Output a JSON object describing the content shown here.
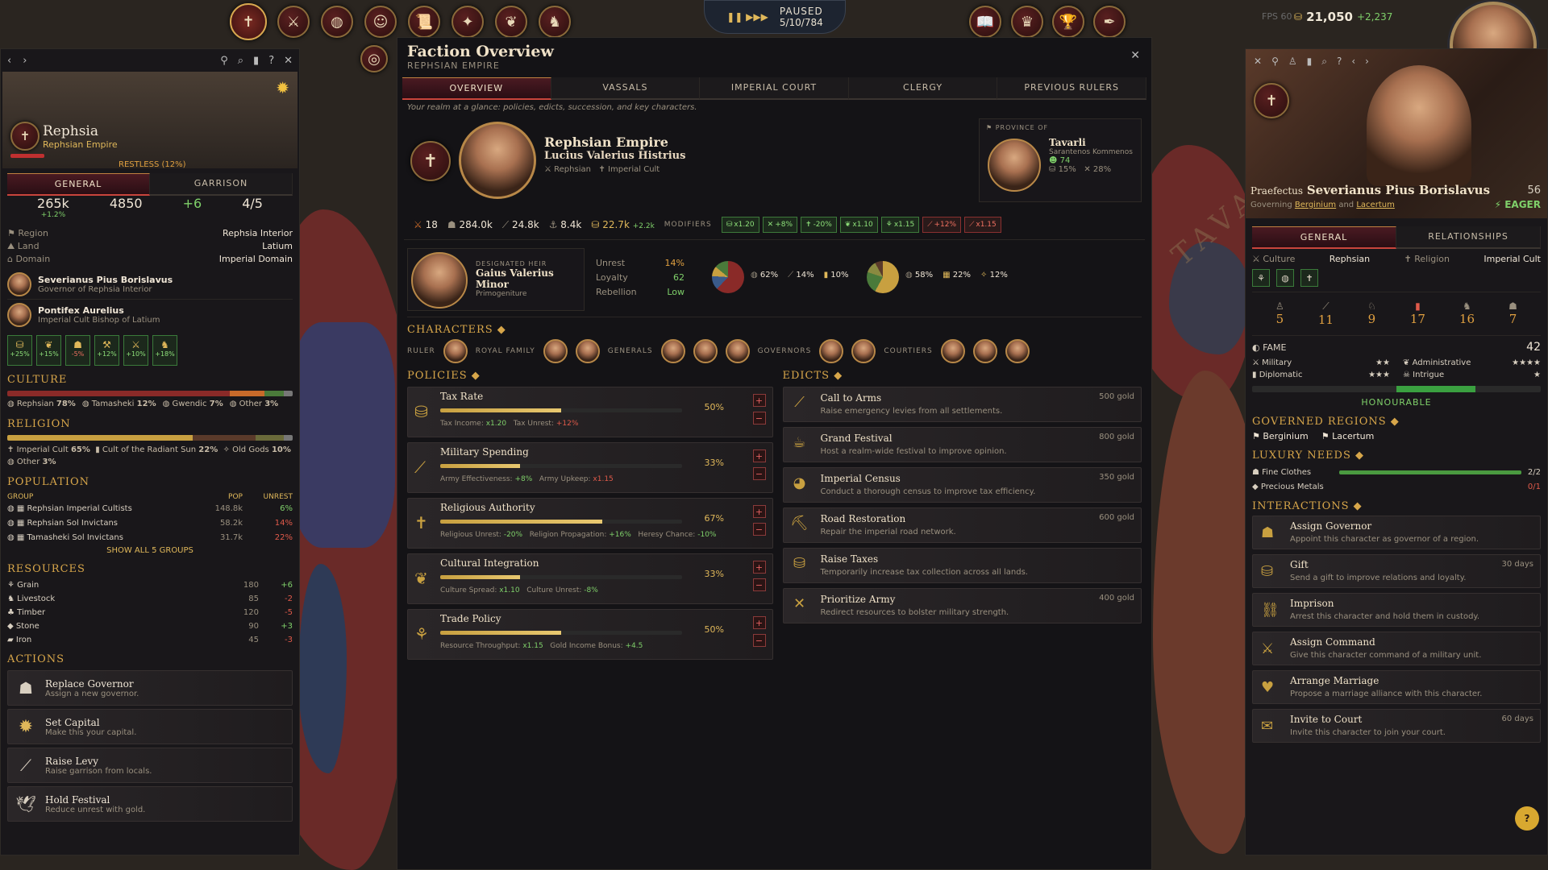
{
  "topbar": {
    "icons_left": [
      "cross-icon",
      "sword-icon",
      "globe-icon",
      "bust-icon",
      "scroll-icon",
      "map-icon",
      "laurel-icon",
      "soldier-icon"
    ],
    "icons_right": [
      "book-icon",
      "crown-helmet-icon",
      "trophy-icon",
      "quill-icon"
    ],
    "status": "PAUSED",
    "date": "5/10/784",
    "speed": "▮▮ ▶▶▶",
    "fps": "FPS 60",
    "gold": "21,050",
    "gold_delta": "+2,237"
  },
  "left": {
    "faction_name": "Rephsia",
    "faction_sub": "Rephsian Empire",
    "mood": "RESTLESS (12%)",
    "tabs": [
      "GENERAL",
      "GARRISON"
    ],
    "stats": [
      {
        "v": "265k",
        "s": "+1.2%"
      },
      {
        "v": "4850",
        "s": ""
      },
      {
        "v": "+6",
        "s": ""
      },
      {
        "v": "4/5",
        "s": ""
      }
    ],
    "info": [
      {
        "k": "Region",
        "v": "Rephsia Interior"
      },
      {
        "k": "Land",
        "v": "Latium"
      },
      {
        "k": "Domain",
        "v": "Imperial Domain"
      }
    ],
    "people": [
      {
        "name": "Severianus Pius Borislavus",
        "role": "Governor of Rephsia Interior"
      },
      {
        "name": "Pontifex Aurelius",
        "role": "Imperial Cult Bishop of Latium"
      }
    ],
    "bonuses": [
      "+25%",
      "+15%",
      "-5%",
      "+12%",
      "+10%",
      "+18%"
    ],
    "culture_title": "CULTURE",
    "culture": [
      {
        "n": "Rephsian",
        "p": "78%"
      },
      {
        "n": "Tamasheki",
        "p": "12%"
      },
      {
        "n": "Gwendic",
        "p": "7%"
      },
      {
        "n": "Other",
        "p": "3%"
      }
    ],
    "religion_title": "RELIGION",
    "religion": [
      {
        "n": "Imperial Cult",
        "p": "65%"
      },
      {
        "n": "Cult of the Radiant Sun",
        "p": "22%"
      },
      {
        "n": "Old Gods",
        "p": "10%"
      },
      {
        "n": "Other",
        "p": "3%"
      }
    ],
    "population_title": "POPULATION",
    "pop_headers": [
      "GROUP",
      "POP",
      "UNREST"
    ],
    "pop": [
      {
        "g": "Rephsian Imperial Cultists",
        "p": "148.8k",
        "u": "6%"
      },
      {
        "g": "Rephsian Sol Invictans",
        "p": "58.2k",
        "u": "14%"
      },
      {
        "g": "Tamasheki Sol Invictans",
        "p": "31.7k",
        "u": "22%"
      }
    ],
    "show_all": "SHOW ALL 5 GROUPS",
    "resources_title": "RESOURCES",
    "resources": [
      {
        "n": "Grain",
        "v": "180",
        "d": "+6"
      },
      {
        "n": "Livestock",
        "v": "85",
        "d": "-2"
      },
      {
        "n": "Timber",
        "v": "120",
        "d": "-5"
      },
      {
        "n": "Stone",
        "v": "90",
        "d": "+3"
      },
      {
        "n": "Iron",
        "v": "45",
        "d": "-3"
      }
    ],
    "actions_title": "ACTIONS",
    "actions": [
      {
        "t": "Replace Governor",
        "d": "Assign a new governor."
      },
      {
        "t": "Set Capital",
        "d": "Make this your capital."
      },
      {
        "t": "Raise Levy",
        "d": "Raise garrison from locals."
      },
      {
        "t": "Hold Festival",
        "d": "Reduce unrest with gold."
      }
    ]
  },
  "center": {
    "title": "Faction Overview",
    "subtitle": "REPHSIAN EMPIRE",
    "tabs": [
      "OVERVIEW",
      "VASSALS",
      "IMPERIAL COURT",
      "CLERGY",
      "PREVIOUS RULERS"
    ],
    "tagline": "Your realm at a glance: policies, edicts, succession, and key characters.",
    "empire": "Rephsian Empire",
    "ruler": "Lucius Valerius Histrius",
    "culture": "Rephsian",
    "religion": "Imperial Cult",
    "province_label": "PROVINCE OF",
    "province_name": "Tavarli",
    "province_ruler": "Sarantenos Kommenos",
    "province_v1": "74",
    "province_v2": "15%",
    "province_v3": "28%",
    "summary": [
      "18",
      "284.0k",
      "24.8k",
      "8.4k",
      "22.7k",
      "+2.2k"
    ],
    "modifiers_label": "MODIFIERS",
    "modifiers": [
      {
        "v": "x1.20",
        "neg": false
      },
      {
        "v": "+8%",
        "neg": false
      },
      {
        "v": "-20%",
        "neg": false
      },
      {
        "v": "x1.10",
        "neg": false
      },
      {
        "v": "x1.15",
        "neg": false
      },
      {
        "v": "+12%",
        "neg": true
      },
      {
        "v": "x1.15",
        "neg": true
      }
    ],
    "heir_label": "DESIGNATED HEIR",
    "heir": "Gaius Valerius Minor",
    "heir_law": "Primogeniture",
    "stability": [
      {
        "k": "Unrest",
        "v": "14%"
      },
      {
        "k": "Loyalty",
        "v": "62"
      },
      {
        "k": "Rebellion",
        "v": "Low"
      }
    ],
    "pie1": [
      "62%",
      "14%",
      "10%"
    ],
    "pie2": [
      "58%",
      "22%",
      "12%"
    ],
    "characters_title": "CHARACTERS",
    "char_groups": [
      {
        "l": "RULER",
        "n": 1
      },
      {
        "l": "ROYAL FAMILY",
        "n": 2
      },
      {
        "l": "GENERALS",
        "n": 3
      },
      {
        "l": "GOVERNORS",
        "n": 2
      },
      {
        "l": "COURTIERS",
        "n": 3
      }
    ],
    "policies_title": "POLICIES",
    "policies": [
      {
        "t": "Tax Rate",
        "p": "50%",
        "v": 0.5,
        "e": [
          {
            "k": "Tax Income:",
            "v": "x1.20",
            "c": "green"
          },
          {
            "k": "Tax Unrest:",
            "v": "+12%",
            "c": "red"
          }
        ]
      },
      {
        "t": "Military Spending",
        "p": "33%",
        "v": 0.33,
        "e": [
          {
            "k": "Army Effectiveness:",
            "v": "+8%",
            "c": "green"
          },
          {
            "k": "Army Upkeep:",
            "v": "x1.15",
            "c": "red"
          }
        ]
      },
      {
        "t": "Religious Authority",
        "p": "67%",
        "v": 0.67,
        "e": [
          {
            "k": "Religious Unrest:",
            "v": "-20%",
            "c": "green"
          },
          {
            "k": "Religion Propagation:",
            "v": "+16%",
            "c": "green"
          },
          {
            "k": "Heresy Chance:",
            "v": "-10%",
            "c": "green"
          }
        ]
      },
      {
        "t": "Cultural Integration",
        "p": "33%",
        "v": 0.33,
        "e": [
          {
            "k": "Culture Spread:",
            "v": "x1.10",
            "c": "green"
          },
          {
            "k": "Culture Unrest:",
            "v": "-8%",
            "c": "green"
          }
        ]
      },
      {
        "t": "Trade Policy",
        "p": "50%",
        "v": 0.5,
        "e": [
          {
            "k": "Resource Throughput:",
            "v": "x1.15",
            "c": "green"
          },
          {
            "k": "Gold Income Bonus:",
            "v": "+4.5",
            "c": "green"
          }
        ]
      }
    ],
    "edicts_title": "EDICTS",
    "edicts": [
      {
        "t": "Call to Arms",
        "d": "Raise emergency levies from all settlements.",
        "c": "500 gold"
      },
      {
        "t": "Grand Festival",
        "d": "Host a realm-wide festival to improve opinion.",
        "c": "800 gold"
      },
      {
        "t": "Imperial Census",
        "d": "Conduct a thorough census to improve tax efficiency.",
        "c": "350 gold"
      },
      {
        "t": "Road Restoration",
        "d": "Repair the imperial road network.",
        "c": "600 gold"
      },
      {
        "t": "Raise Taxes",
        "d": "Temporarily increase tax collection across all lands.",
        "c": ""
      },
      {
        "t": "Prioritize Army",
        "d": "Redirect resources to bolster military strength.",
        "c": "400 gold"
      }
    ]
  },
  "right": {
    "title_prefix": "Praefectus",
    "name": "Severianus Pius Borislavus",
    "age": "56",
    "governing_pre": "Governing",
    "governing_a": "Berginium",
    "governing_and": "and",
    "governing_b": "Lacertum",
    "mood": "EAGER",
    "tabs": [
      "GENERAL",
      "RELATIONSHIPS"
    ],
    "culture_k": "Culture",
    "culture_v": "Rephsian",
    "religion_k": "Religion",
    "religion_v": "Imperial Cult",
    "attrs": [
      "5",
      "11",
      "9",
      "17",
      "16",
      "7"
    ],
    "fame_k": "FAME",
    "fame_v": "42",
    "skills": [
      {
        "k": "Military",
        "s": "★★"
      },
      {
        "k": "Administrative",
        "s": "★★★★"
      },
      {
        "k": "Diplomatic",
        "s": "★★★"
      },
      {
        "k": "Intrigue",
        "s": "★"
      }
    ],
    "honour": "HONOURABLE",
    "honour_v": 0.55,
    "regions_title": "GOVERNED REGIONS",
    "regions": [
      "Berginium",
      "Lacertum"
    ],
    "luxury_title": "LUXURY NEEDS",
    "luxury": [
      {
        "n": "Fine Clothes",
        "v": "2/2",
        "f": 1
      },
      {
        "n": "Precious Metals",
        "v": "0/1",
        "f": 0
      }
    ],
    "interactions_title": "INTERACTIONS",
    "interactions": [
      {
        "t": "Assign Governor",
        "d": "Appoint this character as governor of a region.",
        "c": ""
      },
      {
        "t": "Gift",
        "d": "Send a gift to improve relations and loyalty.",
        "c": "30 days"
      },
      {
        "t": "Imprison",
        "d": "Arrest this character and hold them in custody.",
        "c": ""
      },
      {
        "t": "Assign Command",
        "d": "Give this character command of a military unit.",
        "c": ""
      },
      {
        "t": "Arrange Marriage",
        "d": "Propose a marriage alliance with this character.",
        "c": ""
      },
      {
        "t": "Invite to Court",
        "d": "Invite this character to join your court.",
        "c": "60 days"
      }
    ],
    "help": "?"
  },
  "colors": {
    "accent": "#d7a64a",
    "positive": "#7fd06a",
    "negative": "#e05a4a",
    "tab_active": "#4a1a22"
  }
}
